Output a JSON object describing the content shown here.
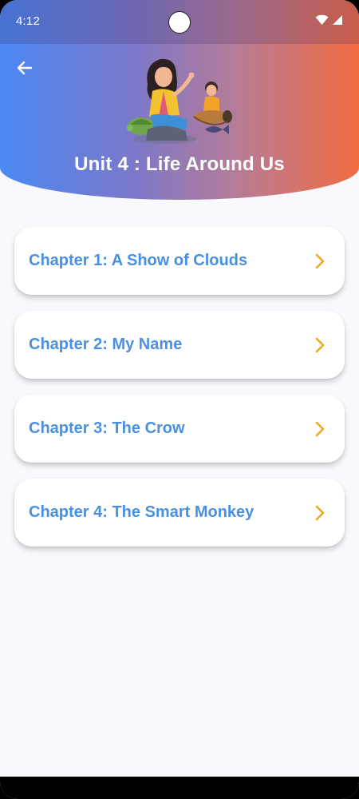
{
  "status_bar": {
    "time": "4:12",
    "icons": [
      "wifi-icon",
      "signal-icon"
    ]
  },
  "header": {
    "back_icon": "arrow-left-icon",
    "illustration": "children-storybook-illustration",
    "title": "Unit 4 : Life Around Us"
  },
  "chapters": [
    {
      "label": "Chapter 1: A Show of Clouds",
      "icon": "chevron-right-icon"
    },
    {
      "label": "Chapter 2: My Name",
      "icon": "chevron-right-icon"
    },
    {
      "label": "Chapter 3: The Crow",
      "icon": "chevron-right-icon"
    },
    {
      "label": "Chapter 4: The Smart Monkey",
      "icon": "chevron-right-icon"
    }
  ],
  "colors": {
    "gradient_start": "#4a88f3",
    "gradient_end": "#f26c42",
    "chapter_text": "#4a90e2",
    "chevron": "#f0a81c",
    "background": "#f9f8fc"
  }
}
